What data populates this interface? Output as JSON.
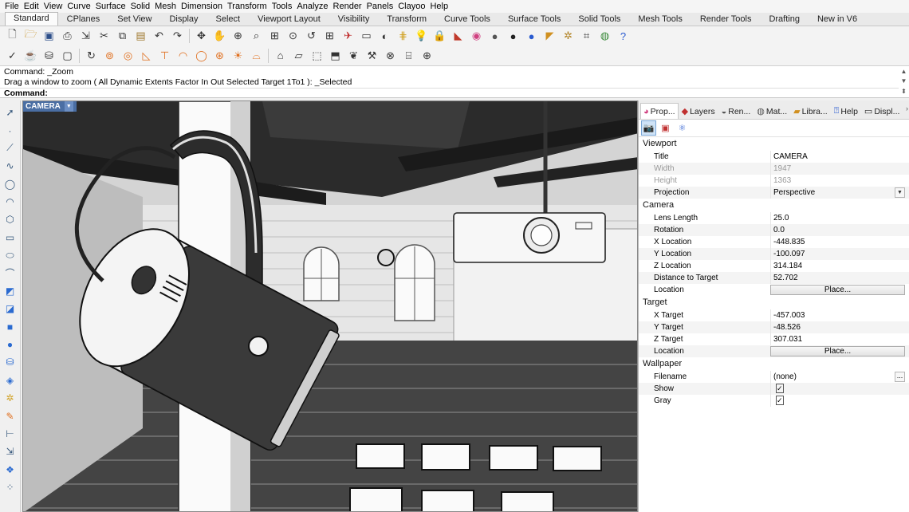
{
  "menu": [
    "File",
    "Edit",
    "View",
    "Curve",
    "Surface",
    "Solid",
    "Mesh",
    "Dimension",
    "Transform",
    "Tools",
    "Analyze",
    "Render",
    "Panels",
    "Clayoo",
    "Help"
  ],
  "tabs": [
    "Standard",
    "CPlanes",
    "Set View",
    "Display",
    "Select",
    "Viewport Layout",
    "Visibility",
    "Transform",
    "Curve Tools",
    "Surface Tools",
    "Solid Tools",
    "Mesh Tools",
    "Render Tools",
    "Drafting",
    "New in V6"
  ],
  "active_tab": "Standard",
  "command": {
    "line1": "Command: _Zoom",
    "line2": "Drag a window to zoom ( All  Dynamic  Extents  Factor  In  Out  Selected  Target  1To1 ): _Selected",
    "prompt": "Command:"
  },
  "toolbar1_icons": [
    "new-icon",
    "open-icon",
    "save-icon",
    "print-icon",
    "import-icon",
    "cut-icon",
    "copy-icon",
    "paste-icon",
    "undo-icon",
    "redo-icon",
    "pan-icon",
    "rotate-view-icon",
    "zoom-icon",
    "zoom-window-icon",
    "zoom-extents-icon",
    "zoom-selected-icon",
    "undo-view-icon",
    "four-view-icon",
    "plane-icon",
    "properties-icon",
    "sun-icon",
    "grid-snap-icon",
    "light-icon",
    "lock-icon",
    "paint-icon",
    "color-wheel-icon",
    "shaded-sphere-icon",
    "rendered-sphere-icon",
    "blue-sphere-icon",
    "pin-icon",
    "settings-icon",
    "layout-icon",
    "globe-icon",
    "help-icon"
  ],
  "toolbar2_icons": [
    "check-icon",
    "teapot-icon",
    "cup-icon",
    "box-icon",
    "rotate-icon",
    "gear-ring-icon",
    "target-icon",
    "triangle-icon",
    "text-t-icon",
    "dome-icon",
    "donut-icon",
    "circle-icon",
    "sun-burst-icon",
    "bell-icon",
    "arch-icon",
    "flat-icon",
    "cube-icon",
    "cube-open-icon",
    "plant-icon",
    "wrench-icon",
    "grid-globe-icon",
    "cylinder-icon",
    "crosshair-icon"
  ],
  "left_icons": [
    "select-arrow-icon",
    "point-icon",
    "polyline-icon",
    "curve-icon",
    "circle-icon",
    "arc-icon",
    "polygon-icon",
    "rectangle-icon",
    "ellipse-icon",
    "curve-spline-icon",
    "surface-icon",
    "surface-patch-icon",
    "box-solid-icon",
    "sphere-icon",
    "cylinder-solid-icon",
    "mesh-icon",
    "fillet-icon",
    "pencil-icon",
    "dimension-icon",
    "transform-icon",
    "object-snap-icon",
    "settings-icon"
  ],
  "viewport": {
    "title": "CAMERA"
  },
  "panel": {
    "tabs": [
      {
        "icon": "color-ball-icon",
        "label": "Prop..."
      },
      {
        "icon": "layers-icon",
        "label": "Layers"
      },
      {
        "icon": "render-icon",
        "label": "Ren..."
      },
      {
        "icon": "material-icon",
        "label": "Mat..."
      },
      {
        "icon": "library-icon",
        "label": "Libra..."
      },
      {
        "icon": "help-icon",
        "label": "Help"
      },
      {
        "icon": "display-icon",
        "label": "Displ..."
      }
    ],
    "icons": [
      "camera-icon",
      "frame-icon",
      "molecule-icon"
    ],
    "viewport_section": "Viewport",
    "title_label": "Title",
    "title_value": "CAMERA",
    "width_label": "Width",
    "width_value": "1947",
    "height_label": "Height",
    "height_value": "1363",
    "projection_label": "Projection",
    "projection_value": "Perspective",
    "camera_section": "Camera",
    "lens_label": "Lens Length",
    "lens_value": "25.0",
    "rotation_label": "Rotation",
    "rotation_value": "0.0",
    "xloc_label": "X Location",
    "xloc_value": "-448.835",
    "yloc_label": "Y Location",
    "yloc_value": "-100.097",
    "zloc_label": "Z Location",
    "zloc_value": "314.184",
    "dist_label": "Distance to Target",
    "dist_value": "52.702",
    "location_label": "Location",
    "place_button": "Place...",
    "target_section": "Target",
    "xt_label": "X Target",
    "xt_value": "-457.003",
    "yt_label": "Y Target",
    "yt_value": "-48.526",
    "zt_label": "Z Target",
    "zt_value": "307.031",
    "tlocation_label": "Location",
    "tplace_button": "Place...",
    "wallpaper_section": "Wallpaper",
    "filename_label": "Filename",
    "filename_value": "(none)",
    "browse_button": "...",
    "show_label": "Show",
    "show_checked": true,
    "gray_label": "Gray",
    "gray_checked": true
  },
  "colors": {
    "viewport_title_bg": "#4a6ea3",
    "active_tab_bg": "#fbfbfb",
    "selected_icon_bg": "#cfe3f7"
  }
}
